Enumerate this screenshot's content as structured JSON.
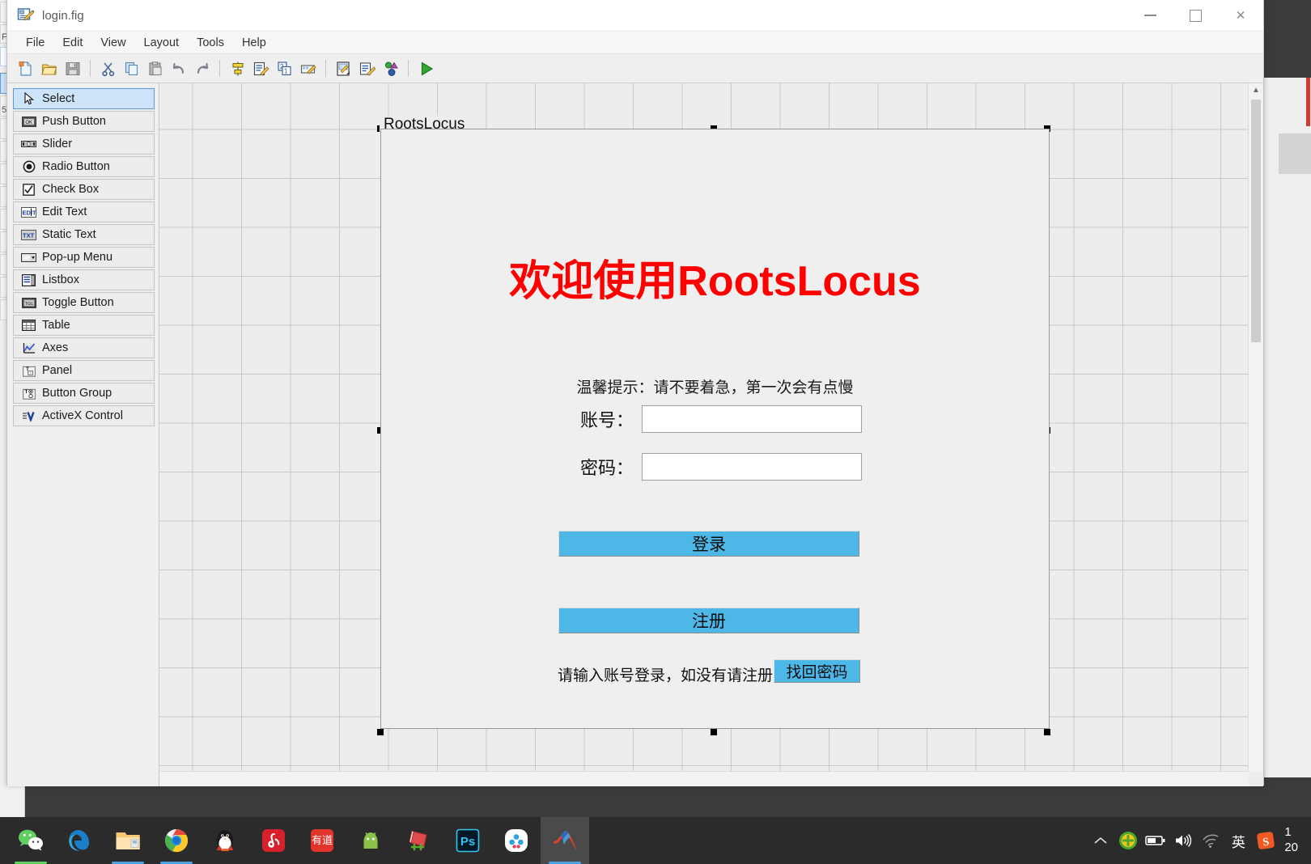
{
  "window": {
    "title": "login.fig",
    "title_icon": "guide-figure-icon",
    "controls": {
      "minimize": "minimize-icon",
      "maximize": "maximize-icon",
      "close": "close-icon"
    }
  },
  "menubar": {
    "items": [
      {
        "label": "File"
      },
      {
        "label": "Edit"
      },
      {
        "label": "View"
      },
      {
        "label": "Layout"
      },
      {
        "label": "Tools"
      },
      {
        "label": "Help"
      }
    ]
  },
  "toolbar": {
    "buttons": [
      {
        "name": "new-figure-icon",
        "title": "New"
      },
      {
        "name": "open-folder-icon",
        "title": "Open"
      },
      {
        "name": "save-icon",
        "title": "Save"
      },
      {
        "name": "separator-1",
        "title": ""
      },
      {
        "name": "cut-scissors-icon",
        "title": "Cut"
      },
      {
        "name": "copy-icon",
        "title": "Copy"
      },
      {
        "name": "paste-icon",
        "title": "Paste"
      },
      {
        "name": "undo-arrow-icon",
        "title": "Undo"
      },
      {
        "name": "redo-arrow-icon",
        "title": "Redo"
      },
      {
        "name": "separator-2",
        "title": ""
      },
      {
        "name": "align-objects-icon",
        "title": "Align Objects"
      },
      {
        "name": "menu-editor-icon",
        "title": "Menu Editor"
      },
      {
        "name": "tab-order-editor-icon",
        "title": "Tab Order Editor"
      },
      {
        "name": "toolbar-editor-icon",
        "title": "Toolbar Editor"
      },
      {
        "name": "separator-3",
        "title": ""
      },
      {
        "name": "m-file-editor-icon",
        "title": "M-file Editor"
      },
      {
        "name": "property-inspector-icon",
        "title": "Property Inspector"
      },
      {
        "name": "object-browser-icon",
        "title": "Object Browser"
      },
      {
        "name": "separator-4",
        "title": ""
      },
      {
        "name": "run-figure-icon",
        "title": "Run Figure"
      }
    ]
  },
  "palette": {
    "items": [
      {
        "label": "Select",
        "icon": "cursor-arrow-icon",
        "selected": true
      },
      {
        "label": "Push Button",
        "icon": "push-button-icon",
        "selected": false
      },
      {
        "label": "Slider",
        "icon": "slider-icon",
        "selected": false
      },
      {
        "label": "Radio Button",
        "icon": "radio-button-icon",
        "selected": false
      },
      {
        "label": "Check Box",
        "icon": "check-box-icon",
        "selected": false
      },
      {
        "label": "Edit Text",
        "icon": "edit-text-icon",
        "selected": false
      },
      {
        "label": "Static Text",
        "icon": "static-text-icon",
        "selected": false
      },
      {
        "label": "Pop-up Menu",
        "icon": "popup-menu-icon",
        "selected": false
      },
      {
        "label": "Listbox",
        "icon": "listbox-icon",
        "selected": false
      },
      {
        "label": "Toggle Button",
        "icon": "toggle-button-icon",
        "selected": false
      },
      {
        "label": "Table",
        "icon": "table-icon",
        "selected": false
      },
      {
        "label": "Axes",
        "icon": "axes-icon",
        "selected": false
      },
      {
        "label": "Panel",
        "icon": "panel-icon",
        "selected": false
      },
      {
        "label": "Button Group",
        "icon": "button-group-icon",
        "selected": false
      },
      {
        "label": "ActiveX Control",
        "icon": "activex-control-icon",
        "selected": false
      }
    ]
  },
  "canvas": {
    "panel": {
      "title": "RootsLocus",
      "heading": "欢迎使用RootsLocus",
      "heading_color": "#ff0000",
      "hint_top": "温馨提示：请不要着急，第一次会有点慢",
      "fields": [
        {
          "label": "账号：",
          "value": "",
          "placeholder": ""
        },
        {
          "label": "密码：",
          "value": "",
          "placeholder": ""
        }
      ],
      "buttons": [
        {
          "label": "登录",
          "color": "#4db7e8"
        },
        {
          "label": "注册",
          "color": "#4db7e8"
        }
      ],
      "hint_bottom": "请输入账号登录，如没有请注册",
      "recover_button": {
        "label": "找回密码",
        "color": "#4db7e8"
      }
    }
  },
  "scrollbars": {
    "vertical_up": "chevron-up-icon",
    "vertical_down": "chevron-down-icon",
    "horizontal_left": "chevron-left-icon",
    "horizontal_right": "chevron-right-icon"
  },
  "taskbar": {
    "apps": [
      {
        "name": "wechat-icon",
        "underline": "#5fd05f"
      },
      {
        "name": "edge-browser-icon",
        "underline": ""
      },
      {
        "name": "file-explorer-icon",
        "underline": "#4aa3e0"
      },
      {
        "name": "chrome-browser-icon",
        "underline": "#4aa3e0"
      },
      {
        "name": "qq-icon",
        "underline": ""
      },
      {
        "name": "netease-music-icon",
        "underline": ""
      },
      {
        "name": "youdao-dictionary-icon",
        "underline": ""
      },
      {
        "name": "android-studio-icon",
        "underline": ""
      },
      {
        "name": "devcpp-icon",
        "underline": ""
      },
      {
        "name": "photoshop-icon",
        "underline": ""
      },
      {
        "name": "baidu-netdisk-icon",
        "underline": ""
      },
      {
        "name": "matlab-icon",
        "underline": "#4aa3e0",
        "active": true
      }
    ],
    "tray": [
      {
        "name": "chevron-up-icon",
        "label": ""
      },
      {
        "name": "security-shield-icon",
        "label": ""
      },
      {
        "name": "battery-icon",
        "label": ""
      },
      {
        "name": "volume-icon",
        "label": ""
      },
      {
        "name": "wifi-icon",
        "label": ""
      },
      {
        "name": "ime-language-icon",
        "label": "英"
      },
      {
        "name": "sogou-input-icon",
        "label": ""
      }
    ],
    "clock": {
      "time": "1",
      "date": "20"
    }
  }
}
